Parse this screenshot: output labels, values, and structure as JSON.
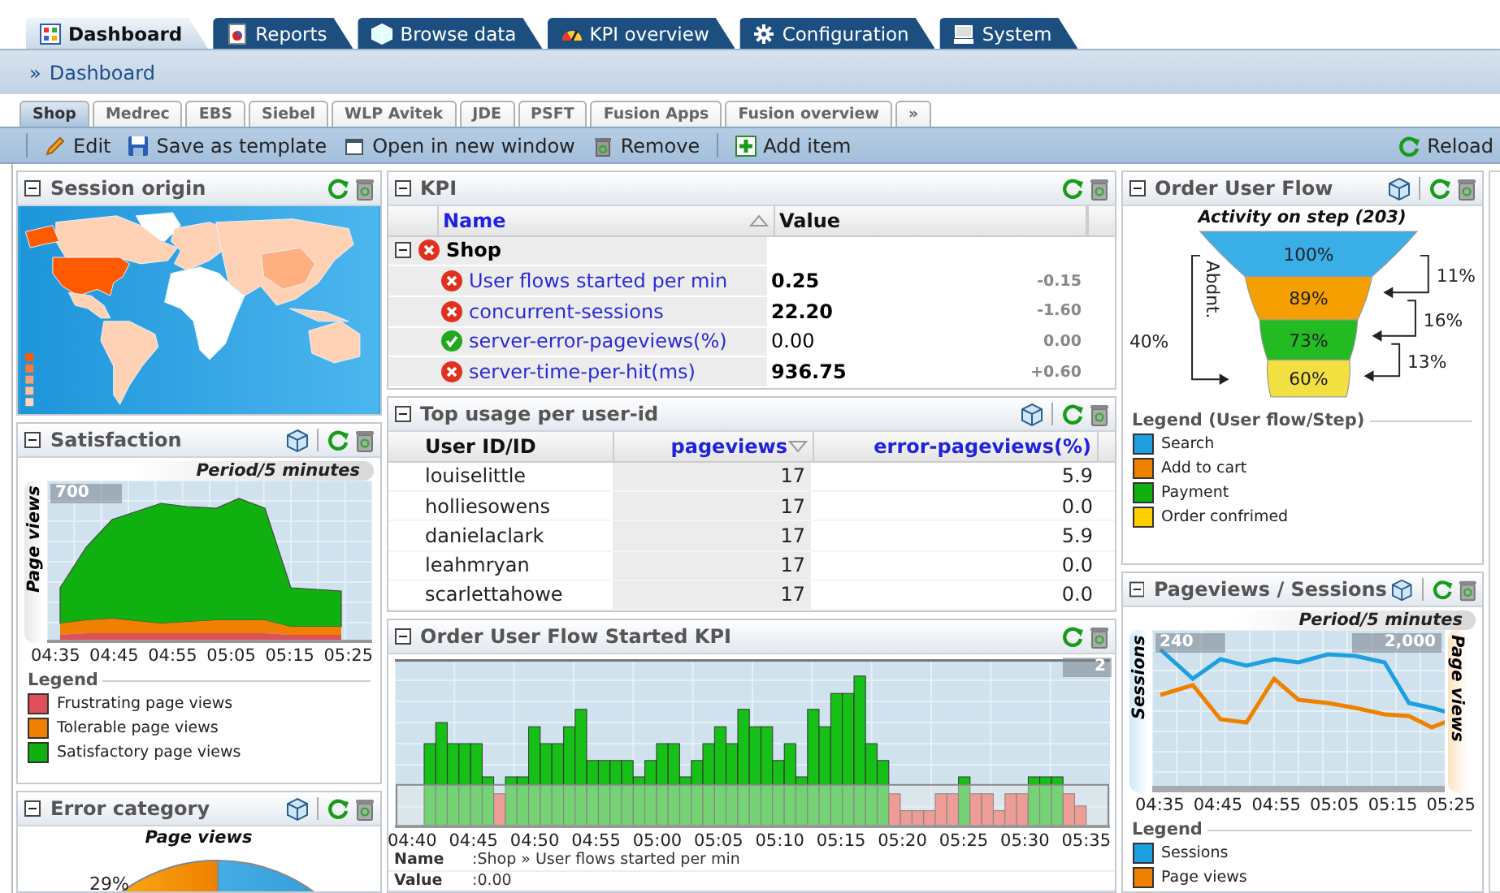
{
  "main_tabs": [
    {
      "label": "Dashboard",
      "selected": true
    },
    {
      "label": "Reports",
      "selected": false
    },
    {
      "label": "Browse data",
      "selected": false
    },
    {
      "label": "KPI overview",
      "selected": false
    },
    {
      "label": "Configuration",
      "selected": false
    },
    {
      "label": "System",
      "selected": false
    }
  ],
  "breadcrumb": {
    "separator": "»",
    "label": "Dashboard"
  },
  "sub_tabs": [
    {
      "label": "Shop",
      "selected": true
    },
    {
      "label": "Medrec",
      "selected": false
    },
    {
      "label": "EBS",
      "selected": false
    },
    {
      "label": "Siebel",
      "selected": false
    },
    {
      "label": "WLP Avitek",
      "selected": false
    },
    {
      "label": "JDE",
      "selected": false
    },
    {
      "label": "PSFT",
      "selected": false
    },
    {
      "label": "Fusion Apps",
      "selected": false
    },
    {
      "label": "Fusion overview",
      "selected": false
    }
  ],
  "sub_tabs_more": "»",
  "toolbar": {
    "items": [
      {
        "kind": "edit",
        "label": "Edit"
      },
      {
        "kind": "save",
        "label": "Save as template"
      },
      {
        "kind": "window",
        "label": "Open in new window"
      },
      {
        "kind": "remove",
        "label": "Remove"
      },
      {
        "kind": "add",
        "label": "Add item"
      }
    ],
    "reload": "Reload"
  },
  "columns": [
    {
      "panels": [
        {
          "kind": "map",
          "title": "Session origin",
          "cube": false
        },
        {
          "kind": "area",
          "title": "Satisfaction",
          "cube": true,
          "period": "Period/5 minutes",
          "y_label": "Page views",
          "y_tick": "700",
          "x_labels": [
            "04:35",
            "04:45",
            "04:55",
            "05:05",
            "05:15",
            "05:25"
          ],
          "legend_title": "Legend",
          "legend": [
            {
              "label": "Frustrating page views",
              "color": "#e0505a"
            },
            {
              "label": "Tolerable page views",
              "color": "#f08000"
            },
            {
              "label": "Satisfactory page views",
              "color": "#10b010"
            }
          ]
        },
        {
          "kind": "pie",
          "title": "Error category",
          "cube": true,
          "chart_title": "Page views",
          "slice_label": "29%"
        }
      ]
    },
    {
      "panels": [
        {
          "kind": "kpi",
          "title": "KPI",
          "cube": false,
          "columns": [
            {
              "label": "Name",
              "sortable": true,
              "sorted": true,
              "descending": false
            },
            {
              "label": "Value",
              "sortable": false,
              "sorted": false
            }
          ],
          "group": {
            "name": "Shop",
            "error": true,
            "expanded": true
          },
          "rows": [
            {
              "name": "User flows started per min",
              "error": true,
              "value": "0.25",
              "change": "-0.15"
            },
            {
              "name": "concurrent-sessions",
              "error": true,
              "value": "22.20",
              "change": "-1.60"
            },
            {
              "name": "server-error-pageviews(%)",
              "error": false,
              "value": "0.00",
              "change": "0.00"
            },
            {
              "name": "server-time-per-hit(ms)",
              "error": true,
              "value": "936.75",
              "change": "+0.60"
            }
          ]
        },
        {
          "kind": "table",
          "title": "Top usage per user-id",
          "cube": true,
          "columns": [
            {
              "label": "User ID/ID",
              "sortable": false,
              "sorted": false
            },
            {
              "label": "pageviews",
              "sortable": true,
              "sorted": true,
              "descending": true
            },
            {
              "label": "error-pageviews(%)",
              "sortable": true,
              "sorted": false
            }
          ],
          "rows": [
            [
              "louiselittle",
              "17",
              "5.9"
            ],
            [
              "holliesowens",
              "17",
              "0.0"
            ],
            [
              "danielaclark",
              "17",
              "5.9"
            ],
            [
              "leahmryan",
              "17",
              "0.0"
            ],
            [
              "scarlettahowe",
              "17",
              "0.0"
            ]
          ]
        },
        {
          "kind": "bars",
          "title": "Order User Flow Started KPI",
          "cube": false,
          "y_tick": "2",
          "x_labels": [
            "04:40",
            "04:45",
            "04:50",
            "04:55",
            "05:00",
            "05:05",
            "05:10",
            "05:15",
            "05:20",
            "05:25",
            "05:30",
            "05:35"
          ],
          "details": [
            {
              "label": "Name",
              "value": ":Shop » User flows started per min"
            },
            {
              "label": "Value",
              "value": ":0.00"
            }
          ]
        }
      ]
    },
    {
      "panels": [
        {
          "kind": "funnel",
          "title": "Order User Flow",
          "cube": true,
          "chart_title": "Activity on step (203)",
          "abandon_label": "Abdnt.",
          "abandon_total": "40%",
          "steps": [
            {
              "percent": "100%",
              "color": "#3aaee6"
            },
            {
              "percent": "89%",
              "color": "#f5a000"
            },
            {
              "percent": "73%",
              "color": "#22bb22"
            },
            {
              "percent": "60%",
              "color": "#f2e040"
            }
          ],
          "drops": [
            "11%",
            "16%",
            "13%"
          ],
          "legend_title": "Legend (User flow/Step)",
          "legend": [
            {
              "label": "Search",
              "color": "#1ea0e0"
            },
            {
              "label": "Add to cart",
              "color": "#f08000"
            },
            {
              "label": "Payment",
              "color": "#10b010"
            },
            {
              "label": "Order confrimed",
              "color": "#ffd000"
            }
          ]
        },
        {
          "kind": "lines",
          "title": "Pageviews / Sessions",
          "cube": true,
          "period": "Period/5 minutes",
          "left_label": "Sessions",
          "right_label": "Page views",
          "left_tick": "240",
          "right_tick": "2,000",
          "x_labels": [
            "04:35",
            "04:45",
            "04:55",
            "05:05",
            "05:15",
            "05:25"
          ],
          "legend_title": "Legend",
          "legend": [
            {
              "label": "Sessions",
              "color": "#1ea0e0"
            },
            {
              "label": "Page views",
              "color": "#f08000"
            }
          ]
        }
      ]
    }
  ]
}
